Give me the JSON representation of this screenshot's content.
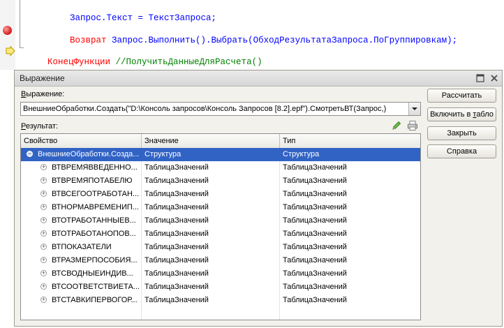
{
  "editor": {
    "line1": {
      "a": "Запрос.Текст = ТекстЗапроса;"
    },
    "line2": {
      "kw": "Возврат",
      "b": " Запрос.Выполнить().Выбрать(ОбходРезультатаЗапроса.ПоГруппировкам);"
    },
    "line3": {
      "kw": "КонецФункции",
      "comment": " //ПолучитьДанныеДляРасчета()"
    },
    "colors": {
      "keyword": "#ff0000",
      "text": "#0000ff",
      "comment": "#008000"
    }
  },
  "dialog": {
    "title": "Выражение",
    "expression_label_first": "В",
    "expression_label_rest": "ыражение:",
    "expression_value": "ВнешниеОбработки.Создать(\"D:\\Консоль запросов\\Консоль Запросов [8.2].epf\").СмотретьВТ(Запрос,)",
    "result_label_first": "Р",
    "result_label_rest": "езультат:",
    "columns": {
      "property": "Свойство",
      "value": "Значение",
      "type": "Тип"
    },
    "rows": [
      {
        "property": "ВнешниеОбработки.Созда...",
        "value": "Структура",
        "type": "Структура"
      },
      {
        "property": "ВТВРЕМЯВВЕДЕННО...",
        "value": "ТаблицаЗначений",
        "type": "ТаблицаЗначений"
      },
      {
        "property": "ВТВРЕМЯПОТАБЕЛЮ",
        "value": "ТаблицаЗначений",
        "type": "ТаблицаЗначений"
      },
      {
        "property": "ВТВСЕГООТРАБОТАН...",
        "value": "ТаблицаЗначений",
        "type": "ТаблицаЗначений"
      },
      {
        "property": "ВТНОРМАВРЕМЕНИП...",
        "value": "ТаблицаЗначений",
        "type": "ТаблицаЗначений"
      },
      {
        "property": "ВТОТРАБОТАННЫЕВ...",
        "value": "ТаблицаЗначений",
        "type": "ТаблицаЗначений"
      },
      {
        "property": "ВТОТРАБОТАНОПОВ...",
        "value": "ТаблицаЗначений",
        "type": "ТаблицаЗначений"
      },
      {
        "property": "ВТПОКАЗАТЕЛИ",
        "value": "ТаблицаЗначений",
        "type": "ТаблицаЗначений"
      },
      {
        "property": "ВТРАЗМЕРПОСОБИЯ...",
        "value": "ТаблицаЗначений",
        "type": "ТаблицаЗначений"
      },
      {
        "property": "ВТСВОДНЫЕИНДИВ...",
        "value": "ТаблицаЗначений",
        "type": "ТаблицаЗначений"
      },
      {
        "property": "ВТСООТВЕТСТВИЕТА...",
        "value": "ТаблицаЗначений",
        "type": "ТаблицаЗначений"
      },
      {
        "property": "ВТСТАВКИПЕРВОГОР...",
        "value": "ТаблицаЗначений",
        "type": "ТаблицаЗначений"
      }
    ],
    "buttons": {
      "calculate": "Рассчитать",
      "to_table_prefix": "Включить в ",
      "to_table_ul": "т",
      "to_table_suffix": "абло",
      "close": "Закрыть",
      "help": "Справка"
    },
    "icons": [
      "maximize-icon",
      "close-icon",
      "pencil-icon",
      "print-icon",
      "breakpoint-icon",
      "execution-arrow-icon",
      "dropdown-arrow-icon"
    ],
    "colors": {
      "selection": "#3163c5",
      "dialog_bg": "#f2f1eb"
    }
  }
}
